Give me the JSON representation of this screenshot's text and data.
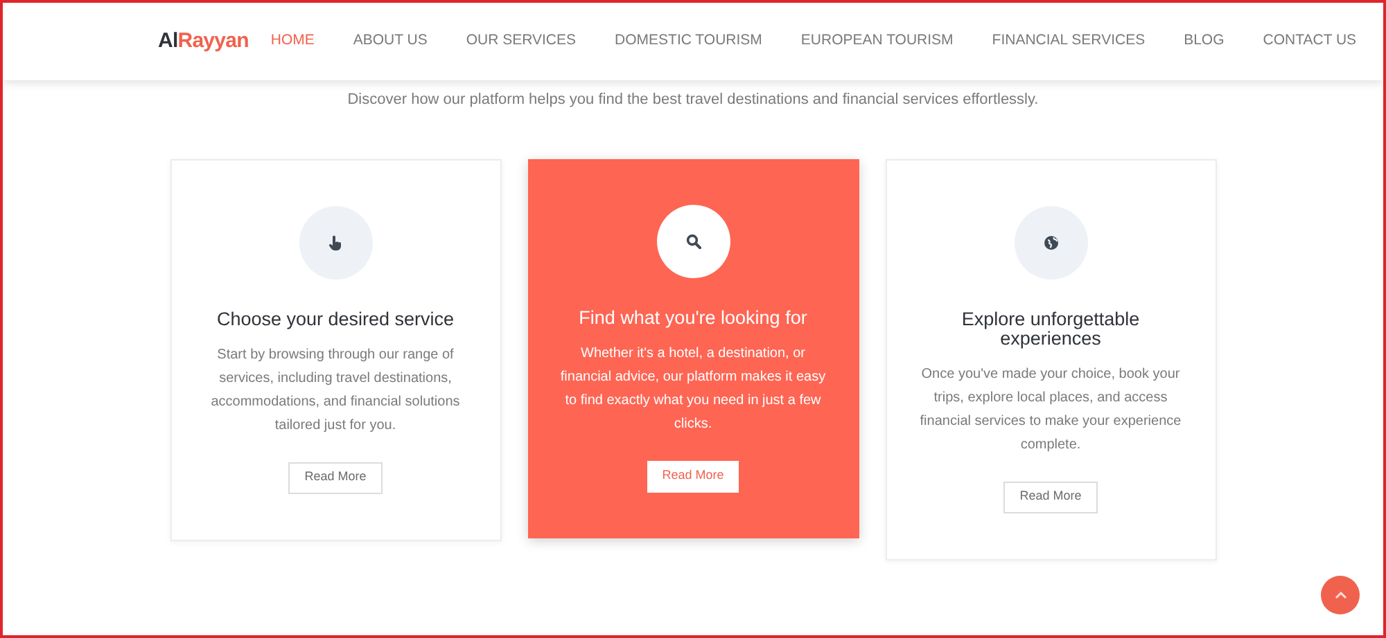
{
  "header": {
    "logo": {
      "dark": "Al",
      "accent": "Rayyan"
    },
    "nav": [
      {
        "label": "HOME",
        "selected": true
      },
      {
        "label": "ABOUT US",
        "selected": false
      },
      {
        "label": "OUR SERVICES",
        "selected": false
      },
      {
        "label": "DOMESTIC TOURISM",
        "selected": false
      },
      {
        "label": "EUROPEAN TOURISM",
        "selected": false
      },
      {
        "label": "FINANCIAL SERVICES",
        "selected": false
      },
      {
        "label": "BLOG",
        "selected": false
      },
      {
        "label": "CONTACT US",
        "selected": false
      }
    ]
  },
  "subtitle": "Discover how our platform helps you find the best travel destinations and financial services effortlessly.",
  "cards": [
    {
      "title": "Choose your desired service",
      "text": "Start by browsing through our range of services, including travel destinations, accommodations, and financial solutions tailored just for you.",
      "button": "Read More",
      "highlighted": false
    },
    {
      "title": "Find what you're looking for",
      "text": "Whether it's a hotel, a destination, or financial advice, our platform makes it easy to find exactly what you need in just a few clicks.",
      "button": "Read More",
      "highlighted": true
    },
    {
      "title": "Explore unforgettable experiences",
      "text": "Once you've made your choice, book your trips, explore local places, and access financial services to make your experience complete.",
      "button": "Read More",
      "highlighted": false
    }
  ]
}
